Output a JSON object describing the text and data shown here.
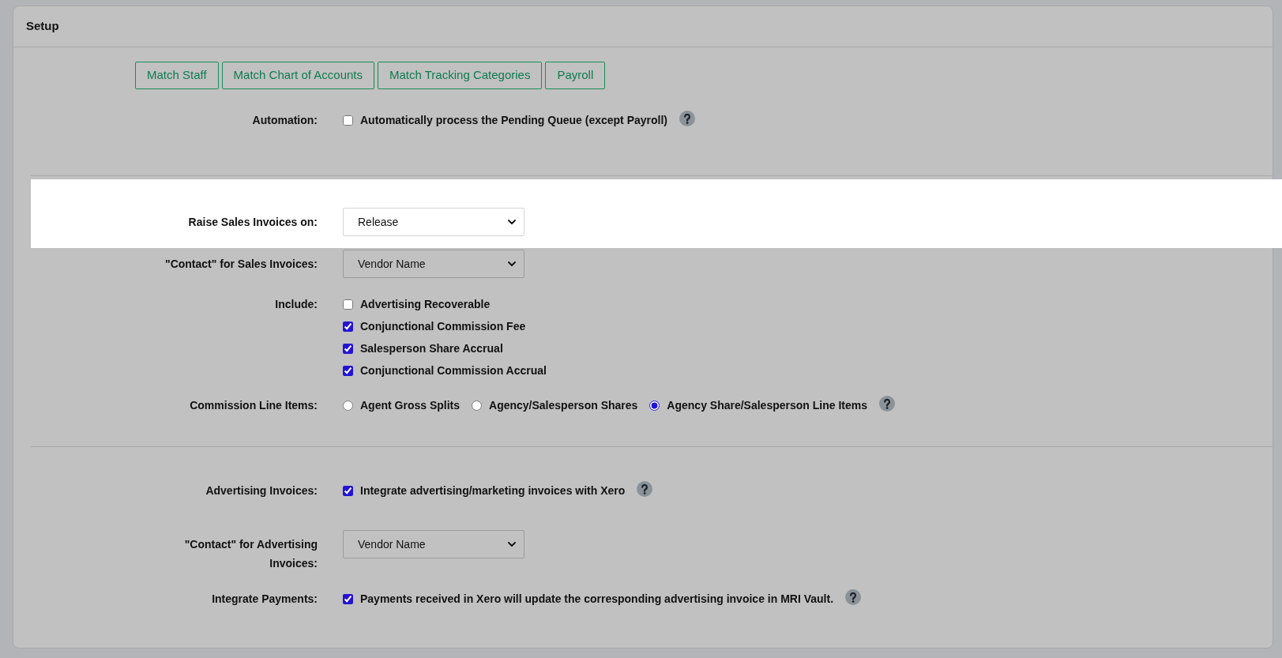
{
  "panel": {
    "title": "Setup"
  },
  "sections": [
    {
      "buttons": [
        {
          "label": "Match Staff"
        },
        {
          "label": "Match Chart of Accounts"
        },
        {
          "label": "Match Tracking Categories"
        },
        {
          "label": "Payroll"
        }
      ],
      "rows": [
        {
          "kind": "checkbox",
          "label": "Automation:",
          "highlighted": false,
          "help": true,
          "options": [
            {
              "label": "Automatically process the Pending Queue (except Payroll)",
              "checked": false
            }
          ]
        }
      ]
    },
    {
      "rows": [
        {
          "kind": "select",
          "label": "Raise Sales Invoices on:",
          "value": "Release",
          "highlighted": true,
          "help": false
        },
        {
          "kind": "select",
          "label": "\"Contact\" for Sales Invoices:",
          "value": "Vendor Name",
          "highlighted": false,
          "help": false
        },
        {
          "kind": "checkbox",
          "label": "Include:",
          "highlighted": false,
          "help": false,
          "options": [
            {
              "label": "Advertising Recoverable",
              "checked": false
            },
            {
              "label": "Conjunctional Commission Fee",
              "checked": true
            },
            {
              "label": "Salesperson Share Accrual",
              "checked": true
            },
            {
              "label": "Conjunctional Commission Accrual",
              "checked": true
            }
          ]
        },
        {
          "kind": "radio",
          "label": "Commission Line Items:",
          "highlighted": false,
          "help": true,
          "options": [
            {
              "label": "Agent Gross Splits",
              "selected": false
            },
            {
              "label": "Agency/Salesperson Shares",
              "selected": false
            },
            {
              "label": "Agency Share/Salesperson Line Items",
              "selected": true
            }
          ]
        }
      ]
    },
    {
      "rows": [
        {
          "kind": "checkbox",
          "label": "Advertising Invoices:",
          "highlighted": false,
          "help": true,
          "options": [
            {
              "label": "Integrate advertising/marketing invoices with Xero",
              "checked": true
            }
          ]
        },
        {
          "kind": "select",
          "label": "\"Contact\" for Advertising Invoices:",
          "value": "Vendor Name",
          "highlighted": false,
          "help": false
        },
        {
          "kind": "checkbox",
          "label": "Integrate Payments:",
          "highlighted": false,
          "help": true,
          "options": [
            {
              "label": "Payments received in Xero will update the corresponding advertising invoice in MRI Vault.",
              "checked": true
            }
          ]
        }
      ]
    }
  ]
}
